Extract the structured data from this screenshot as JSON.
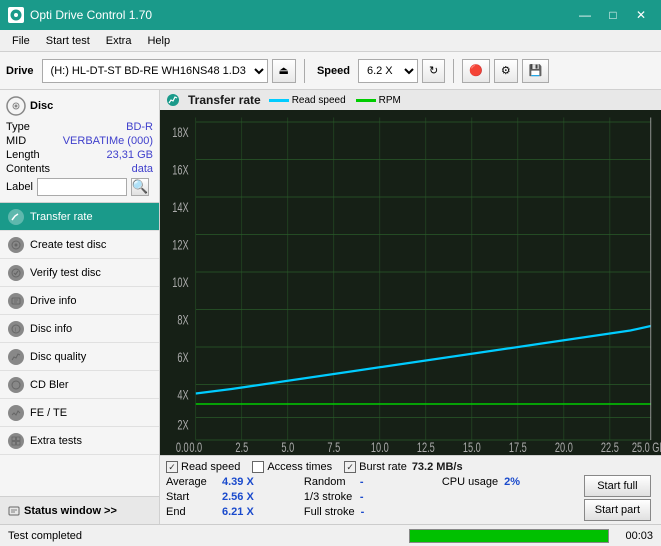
{
  "titlebar": {
    "title": "Opti Drive Control 1.70",
    "controls": {
      "minimize": "—",
      "maximize": "□",
      "close": "✕"
    }
  },
  "menubar": {
    "items": [
      "File",
      "Start test",
      "Extra",
      "Help"
    ]
  },
  "toolbar": {
    "drive_label": "Drive",
    "drive_value": "(H:) HL-DT-ST BD-RE  WH16NS48 1.D3",
    "speed_label": "Speed",
    "speed_value": "6.2 X"
  },
  "disc": {
    "title": "Disc",
    "type_label": "Type",
    "type_value": "BD-R",
    "mid_label": "MID",
    "mid_value": "VERBATIMe (000)",
    "length_label": "Length",
    "length_value": "23,31 GB",
    "contents_label": "Contents",
    "contents_value": "data",
    "label_label": "Label",
    "label_value": ""
  },
  "nav": {
    "items": [
      {
        "id": "transfer-rate",
        "label": "Transfer rate",
        "active": true
      },
      {
        "id": "create-test-disc",
        "label": "Create test disc",
        "active": false
      },
      {
        "id": "verify-test-disc",
        "label": "Verify test disc",
        "active": false
      },
      {
        "id": "drive-info",
        "label": "Drive info",
        "active": false
      },
      {
        "id": "disc-info",
        "label": "Disc info",
        "active": false
      },
      {
        "id": "disc-quality",
        "label": "Disc quality",
        "active": false
      },
      {
        "id": "cd-bler",
        "label": "CD Bler",
        "active": false
      },
      {
        "id": "fe-te",
        "label": "FE / TE",
        "active": false
      },
      {
        "id": "extra-tests",
        "label": "Extra tests",
        "active": false
      }
    ],
    "status_window": "Status window >>"
  },
  "chart": {
    "title": "Transfer rate",
    "legend": [
      {
        "id": "read-speed",
        "label": "Read speed",
        "color": "#00ccff"
      },
      {
        "id": "rpm",
        "label": "RPM",
        "color": "#00cc00"
      }
    ],
    "y_axis": [
      "18X",
      "16X",
      "14X",
      "12X",
      "10X",
      "8X",
      "6X",
      "4X",
      "2X",
      "0.0"
    ],
    "x_axis": [
      "0.0",
      "2.5",
      "5.0",
      "7.5",
      "10.0",
      "12.5",
      "15.0",
      "17.5",
      "20.0",
      "22.5",
      "25.0 GB"
    ]
  },
  "checkboxes": [
    {
      "id": "read-speed-cb",
      "label": "Read speed",
      "checked": true
    },
    {
      "id": "access-times-cb",
      "label": "Access times",
      "checked": false
    },
    {
      "id": "burst-rate-cb",
      "label": "Burst rate",
      "checked": true,
      "value": "73.2 MB/s"
    }
  ],
  "stats": {
    "col1": {
      "rows": [
        {
          "label": "Average",
          "value": "4.39 X"
        },
        {
          "label": "Start",
          "value": "2.56 X"
        },
        {
          "label": "End",
          "value": "6.21 X"
        }
      ]
    },
    "col2": {
      "rows": [
        {
          "label": "Random",
          "value": "-"
        },
        {
          "label": "1/3 stroke",
          "value": "-"
        },
        {
          "label": "Full stroke",
          "value": "-"
        }
      ]
    },
    "col3": {
      "rows": [
        {
          "label": "CPU usage",
          "value": "2%"
        },
        {
          "label": "",
          "value": ""
        },
        {
          "label": "",
          "value": ""
        }
      ]
    },
    "buttons": [
      {
        "id": "start-full",
        "label": "Start full"
      },
      {
        "id": "start-part",
        "label": "Start part"
      }
    ]
  },
  "bottom": {
    "status": "Test completed",
    "progress": 100,
    "time": "00:03"
  },
  "colors": {
    "teal": "#1a9a8a",
    "chart_bg": "#162016",
    "chart_grid": "#2a5a2a",
    "read_line": "#00ccff",
    "rpm_line": "#00cc00",
    "burst_line": "#ff8800"
  }
}
